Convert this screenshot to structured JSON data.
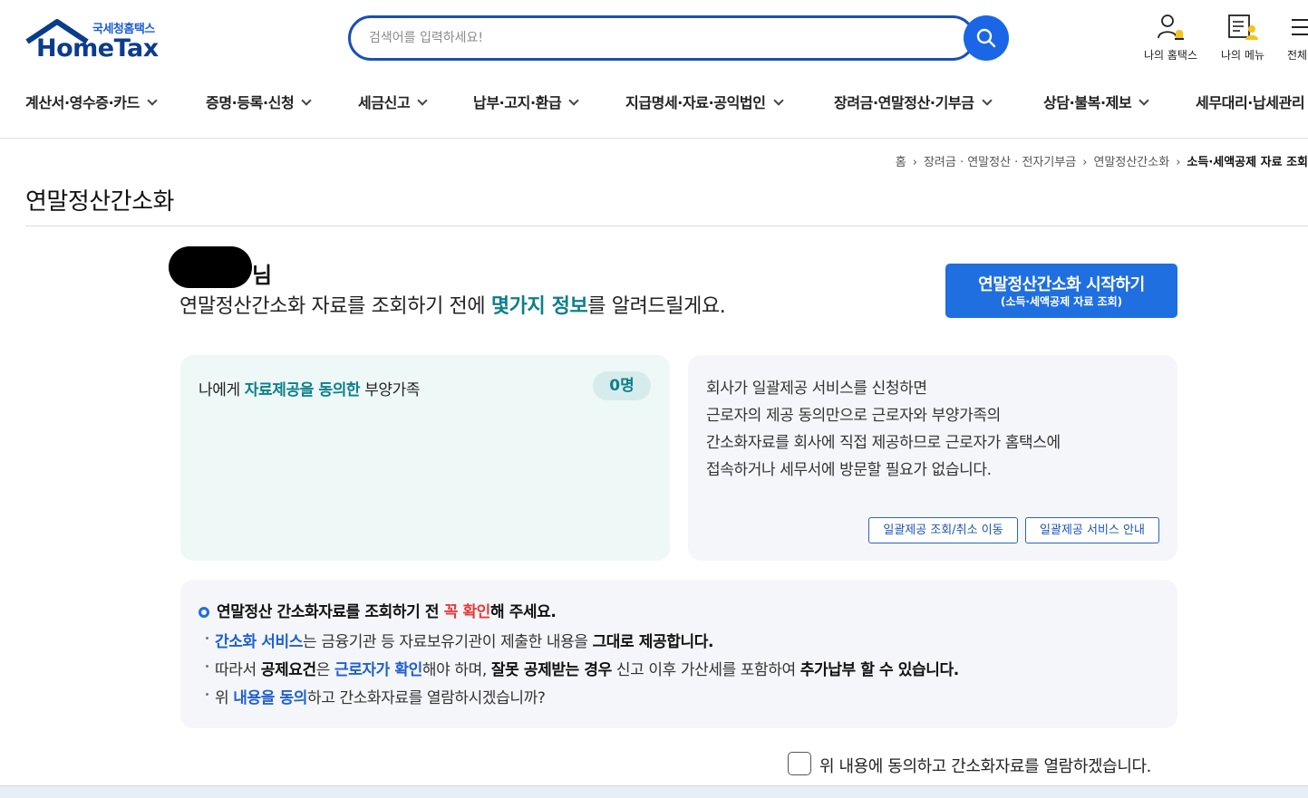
{
  "header": {
    "logo_sub": "국세청홈택스",
    "logo_main": "HomeTax",
    "search_placeholder": "검색어를 입력하세요!",
    "util": [
      {
        "label": "나의 홈택스",
        "icon": "user-bell-icon"
      },
      {
        "label": "나의 메뉴",
        "icon": "menu-user-icon"
      },
      {
        "label": "전체",
        "icon": "hamburger-icon"
      }
    ]
  },
  "gnb": [
    "계산서·영수증·카드",
    "증명·등록·신청",
    "세금신고",
    "납부·고지·환급",
    "지급명세·자료·공익법인",
    "장려금·연말정산·기부금",
    "상담·불복·제보",
    "세무대리·납세관리"
  ],
  "breadcrumb": [
    "홈",
    "장려금 · 연말정산 · 전자기부금",
    "연말정산간소화",
    "소득·세액공제 자료 조회"
  ],
  "page_title": "연말정산간소화",
  "intro": {
    "suffix": "님",
    "pre": "연말정산간소화 자료를 조회하기 전에 ",
    "highlight": "몇가지 정보",
    "post": "를 알려드릴게요."
  },
  "start_button": {
    "line1": "연말정산간소화 시작하기",
    "line2": "(소득·세액공제 자료 조회)"
  },
  "left_card": {
    "pre": "나에게 ",
    "highlight": "자료제공을 동의한",
    "post": " 부양가족",
    "count": "0명"
  },
  "right_card": {
    "lines": [
      "회사가 일괄제공 서비스를 신청하면",
      "근로자의 제공 동의만으로 근로자와 부양가족의",
      "간소화자료를 회사에 직접 제공하므로 근로자가 홈택스에",
      "접속하거나 세무서에 방문할 필요가 없습니다."
    ],
    "btn_lookup": "일괄제공 조회/취소 이동",
    "btn_guide": "일괄제공 서비스 안내"
  },
  "notice": {
    "head_pre": "연말정산 간소화자료를 조회하기 전 ",
    "head_red": "꼭 확인",
    "head_post": "해 주세요.",
    "r1_blue": "간소화 서비스",
    "r1_mid": "는 금융기관 등 자료보유기관이 제출한 내용을 ",
    "r1_bold": "그대로 제공합니다.",
    "r2_pre": "따라서 ",
    "r2_b1": "공제요건",
    "r2_mid1": "은 ",
    "r2_blue": "근로자가 확인",
    "r2_mid2": "해야 하며, ",
    "r2_b2": "잘못 공제받는 경우",
    "r2_mid3": " 신고 이후 가산세를 포함하여 ",
    "r2_b3": "추가납부 할 수 있습니다.",
    "r3_pre": "위 ",
    "r3_blue": "내용을 동의",
    "r3_post": "하고 간소화자료를 열람하시겠습니까?"
  },
  "agree_label": "위 내용에 동의하고 간소화자료를 열람하겠습니다.",
  "colors": {
    "brand_blue": "#1f6fe0",
    "teal": "#0d7f8a",
    "red": "#e53a3a"
  }
}
